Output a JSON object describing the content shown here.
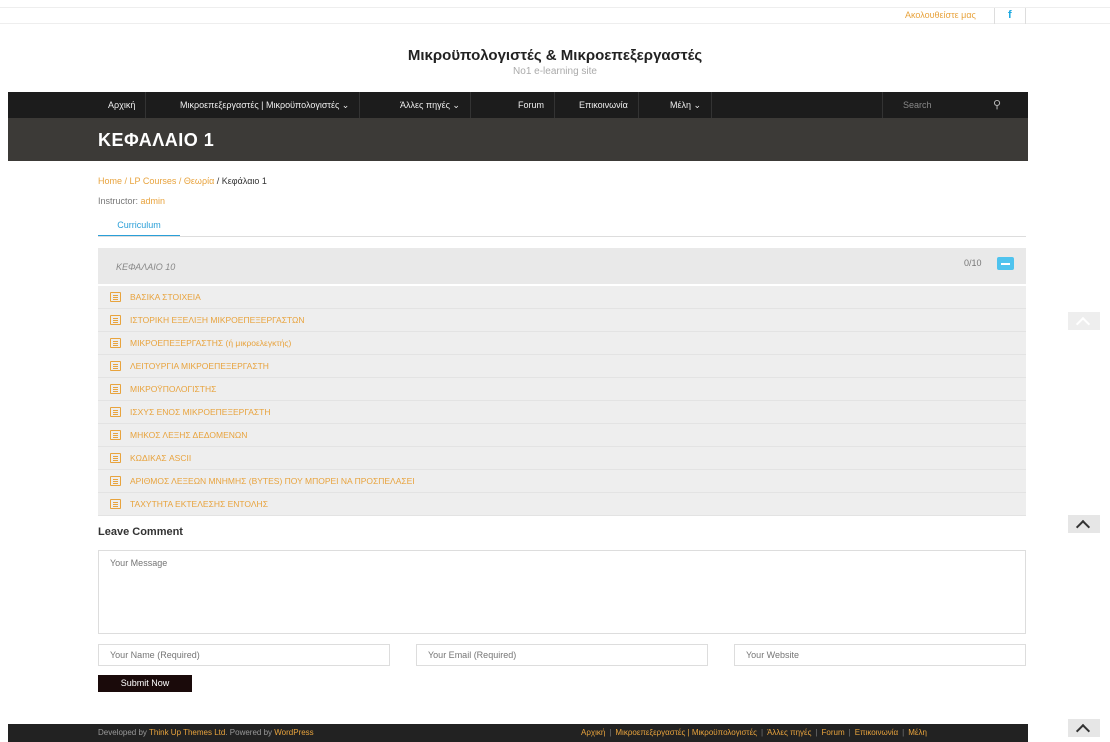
{
  "topbar": {
    "follow_label": "Ακολουθείστε μας",
    "facebook_icon": "facebook-icon"
  },
  "site": {
    "title": "Μικροϋπολογιστές & Μικροεπεξεργαστές",
    "tagline": "No1 e-learning site"
  },
  "nav": {
    "items": [
      "Αρχική",
      "Μικροεπεξεργαστές | Μικροϋπολογιστές ⌄",
      "Άλλες πηγές ⌄",
      "Forum",
      "Επικοινωνία",
      "Μέλη ⌄"
    ],
    "search_placeholder": "Search",
    "search_icon": "search-icon"
  },
  "page": {
    "title": "ΚΕΦΑΛΑΙΟ 1"
  },
  "breadcrumb": {
    "home": "Home",
    "sep": " / ",
    "courses": "LP Courses",
    "category": "Θεωρία",
    "current": "Κεφάλαιο 1"
  },
  "instructor": {
    "label": "Instructor: ",
    "name": "admin"
  },
  "tabs": {
    "curriculum": "Curriculum"
  },
  "section": {
    "title": "ΚΕΦΑΛΑΙΟ 10",
    "count": "0/10",
    "lessons": [
      "ΒΑΣΙΚΑ ΣΤΟΙΧΕΙΑ",
      "ΙΣΤΟΡΙΚΗ ΕΞΕΛΙΞΗ ΜΙΚΡΟΕΠΕΞΕΡΓΑΣΤΩΝ",
      "ΜΙΚΡΟΕΠΕΞΕΡΓΑΣΤΗΣ (ή μικροελεγκτής)",
      "ΛΕΙΤΟΥΡΓΙΑ ΜΙΚΡΟΕΠΕΞΕΡΓΑΣΤΗ",
      "ΜΙΚΡΟΫΠΟΛΟΓΙΣΤΗΣ",
      "ΙΣΧΥΣ ΕΝΟΣ ΜΙΚΡΟΕΠΕΞΕΡΓΑΣΤΗ",
      "ΜΗΚΟΣ ΛΕΞΗΣ ΔΕΔΟΜΕΝΩΝ",
      "ΚΩΔΙΚΑΣ ASCII",
      "ΑΡΙΘΜΟΣ ΛΕΞΕΩΝ ΜΝΗΜΗΣ (BYTES) ΠΟΥ ΜΠΟΡΕΙ ΝΑ ΠΡΟΣΠΕΛΑΣΕΙ",
      "ΤΑΧΥΤΗΤΑ ΕΚΤΕΛΕΣΗΣ ΕΝΤΟΛΗΣ"
    ]
  },
  "comment": {
    "title": "Leave Comment",
    "message_placeholder": "Your Message",
    "name_placeholder": "Your Name (Required)",
    "email_placeholder": "Your Email (Required)",
    "website_placeholder": "Your Website",
    "submit_label": "Submit Now"
  },
  "footer": {
    "developed_by": "Developed by ",
    "theme_link": "Think Up Themes Ltd",
    "powered_by": ". Powered by ",
    "wp_link": "WordPress",
    "links": [
      "Αρχική",
      "Μικροεπεξεργαστές | Μικροϋπολογιστές",
      "Άλλες πηγές",
      "Forum",
      "Επικοινωνία",
      "Μέλη"
    ]
  }
}
